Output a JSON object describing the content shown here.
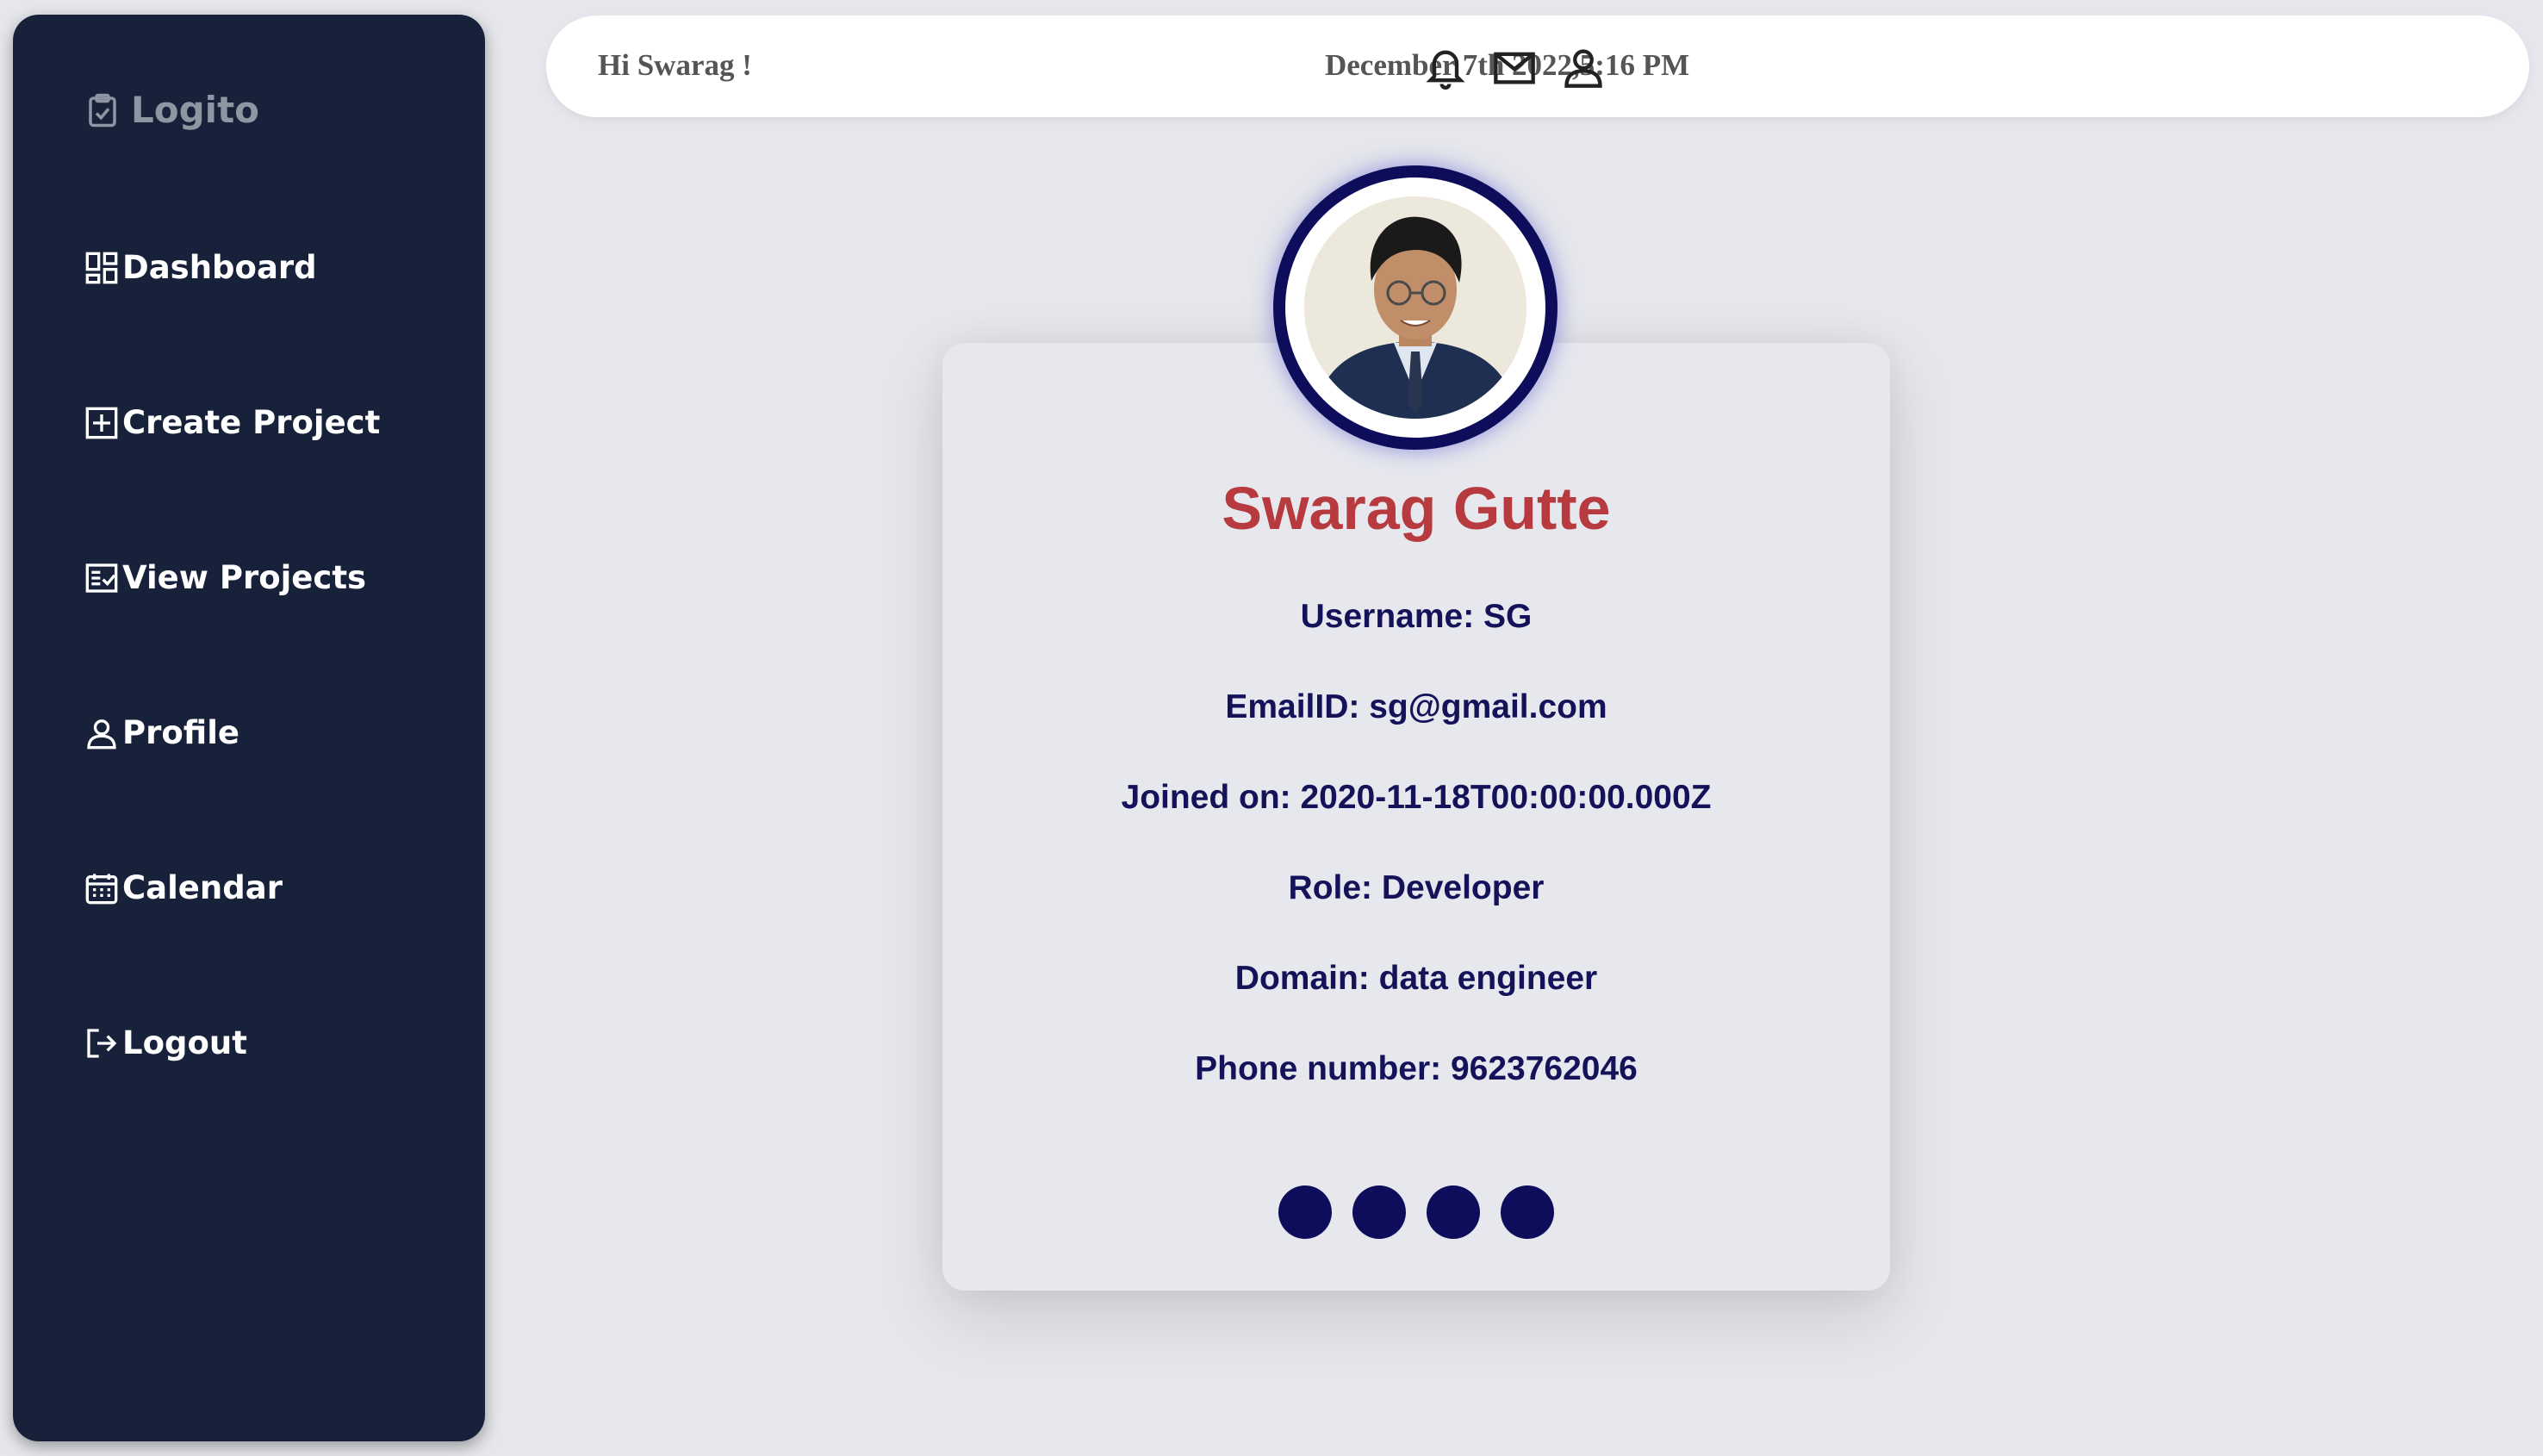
{
  "sidebar": {
    "brand": "Logito",
    "items": [
      {
        "label": "Dashboard",
        "icon": "dashboard-icon"
      },
      {
        "label": "Create Project",
        "icon": "plus-square-icon"
      },
      {
        "label": "View Projects",
        "icon": "checklist-icon"
      },
      {
        "label": "Profile",
        "icon": "user-icon"
      },
      {
        "label": "Calendar",
        "icon": "calendar-icon"
      },
      {
        "label": "Logout",
        "icon": "logout-icon"
      }
    ]
  },
  "header": {
    "greeting": "Hi Swarag !",
    "datetime": "December 7th 2022,5:16 PM",
    "icons": [
      "bell-icon",
      "mail-icon",
      "user-icon"
    ]
  },
  "profile": {
    "name": "Swarag Gutte",
    "username": "Username: SG",
    "email": "EmailID: sg@gmail.com",
    "joined": "Joined on: 2020-11-18T00:00:00.000Z",
    "role": "Role: Developer",
    "domain": "Domain: data engineer",
    "phone": "Phone number: 9623762046",
    "social_dots": 4
  },
  "colors": {
    "sidebar_bg": "#172139",
    "page_bg": "#e6e7ec",
    "name": "#b63a3e",
    "info_text": "#14135a",
    "accent": "#0e0d5c"
  }
}
